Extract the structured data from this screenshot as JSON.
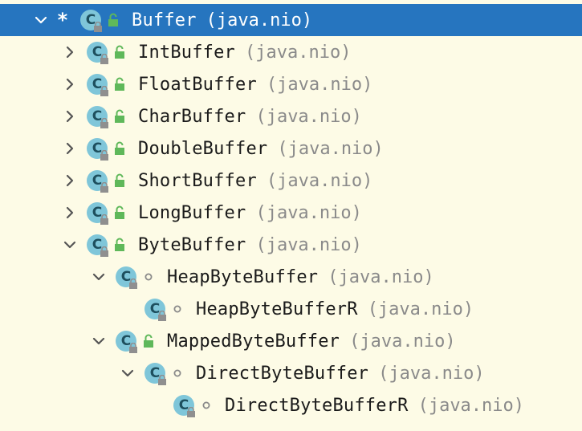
{
  "tree": {
    "rows": [
      {
        "name": "Buffer",
        "package": "(java.nio)",
        "depth": 0,
        "expand": "expanded",
        "marker": "*",
        "selected": true,
        "visibility": "public"
      },
      {
        "name": "IntBuffer",
        "package": "(java.nio)",
        "depth": 1,
        "expand": "collapsed",
        "marker": "",
        "selected": false,
        "visibility": "public"
      },
      {
        "name": "FloatBuffer",
        "package": "(java.nio)",
        "depth": 1,
        "expand": "collapsed",
        "marker": "",
        "selected": false,
        "visibility": "public"
      },
      {
        "name": "CharBuffer",
        "package": "(java.nio)",
        "depth": 1,
        "expand": "collapsed",
        "marker": "",
        "selected": false,
        "visibility": "public"
      },
      {
        "name": "DoubleBuffer",
        "package": "(java.nio)",
        "depth": 1,
        "expand": "collapsed",
        "marker": "",
        "selected": false,
        "visibility": "public"
      },
      {
        "name": "ShortBuffer",
        "package": "(java.nio)",
        "depth": 1,
        "expand": "collapsed",
        "marker": "",
        "selected": false,
        "visibility": "public"
      },
      {
        "name": "LongBuffer",
        "package": "(java.nio)",
        "depth": 1,
        "expand": "collapsed",
        "marker": "",
        "selected": false,
        "visibility": "public"
      },
      {
        "name": "ByteBuffer",
        "package": "(java.nio)",
        "depth": 1,
        "expand": "expanded",
        "marker": "",
        "selected": false,
        "visibility": "public"
      },
      {
        "name": "HeapByteBuffer",
        "package": "(java.nio)",
        "depth": 2,
        "expand": "expanded",
        "marker": "",
        "selected": false,
        "visibility": "package"
      },
      {
        "name": "HeapByteBufferR",
        "package": "(java.nio)",
        "depth": 3,
        "expand": "none",
        "marker": "",
        "selected": false,
        "visibility": "package"
      },
      {
        "name": "MappedByteBuffer",
        "package": "(java.nio)",
        "depth": 2,
        "expand": "expanded",
        "marker": "",
        "selected": false,
        "visibility": "public"
      },
      {
        "name": "DirectByteBuffer",
        "package": "(java.nio)",
        "depth": 3,
        "expand": "expanded",
        "marker": "",
        "selected": false,
        "visibility": "package"
      },
      {
        "name": "DirectByteBufferR",
        "package": "(java.nio)",
        "depth": 4,
        "expand": "none",
        "marker": "",
        "selected": false,
        "visibility": "package"
      }
    ]
  },
  "icons": {
    "class_letter": "C",
    "class_icon": "class-icon",
    "public_icon": "unlocked-padlock-icon",
    "package_icon": "package-private-dot-icon"
  },
  "colors": {
    "background": "#fdfbe6",
    "selection": "#2675bf",
    "class_circle": "#7fc6d9",
    "public_green": "#5fb85a",
    "package_text": "#8a8a8a"
  }
}
